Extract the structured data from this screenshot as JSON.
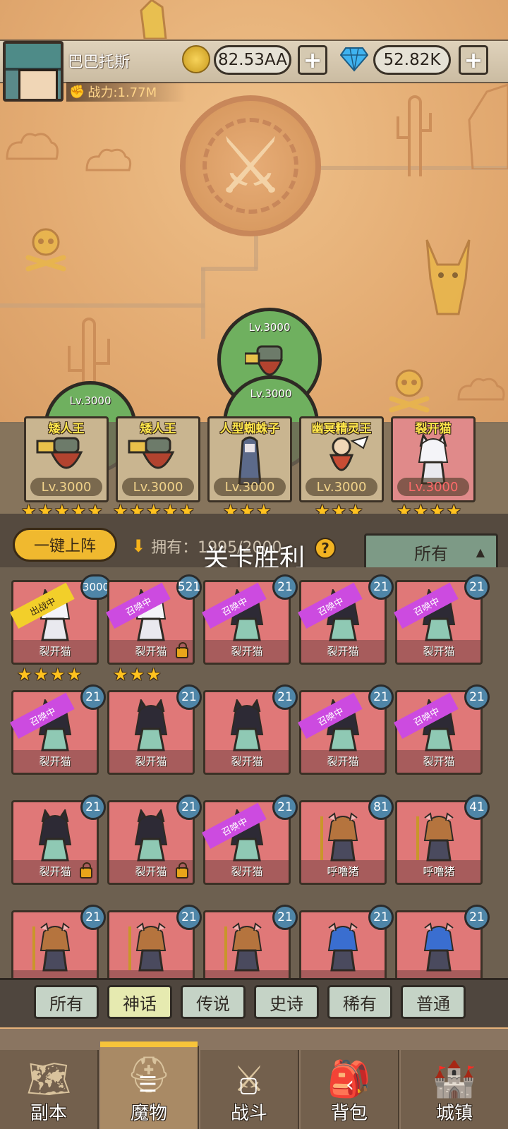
{
  "player": {
    "name": "巴巴托斯",
    "power_label": "战力:1.77M"
  },
  "resources": {
    "gold": "82.53AA",
    "gems": "52.82K",
    "plus": "+"
  },
  "field_units": [
    {
      "level": "Lv.3000"
    },
    {
      "level": "Lv.3000"
    },
    {
      "level": "Lv.3000"
    }
  ],
  "lineup": [
    {
      "name": "矮人王",
      "level": "Lv.3000",
      "stars": 5,
      "rarity": "yellow"
    },
    {
      "name": "矮人王",
      "level": "Lv.3000",
      "stars": 5,
      "rarity": "yellow"
    },
    {
      "name": "人型蜘蛛子",
      "level": "Lv.3000",
      "stars": 3,
      "rarity": "yellow"
    },
    {
      "name": "幽冥精灵王",
      "level": "Lv.3000",
      "stars": 3,
      "rarity": "yellow"
    },
    {
      "name": "裂开猫",
      "level": "Lv.3000",
      "stars": 4,
      "rarity": "pink"
    }
  ],
  "controls": {
    "quick_deploy": "一键上阵",
    "own_label": "拥有：1995/2000",
    "help": "?",
    "filter": "所有",
    "toast": "关卡胜利"
  },
  "monsters": [
    {
      "name": "裂开猫",
      "level": "3000",
      "tag": "出战中",
      "tag_type": "battle",
      "locked": false,
      "stars": 4,
      "kind": "cat-white"
    },
    {
      "name": "裂开猫",
      "level": "521",
      "tag": "召唤中",
      "tag_type": "summon",
      "locked": true,
      "stars": 3,
      "kind": "cat-white"
    },
    {
      "name": "裂开猫",
      "level": "21",
      "tag": "召唤中",
      "tag_type": "summon",
      "locked": false,
      "stars": 0,
      "kind": "cat-black"
    },
    {
      "name": "裂开猫",
      "level": "21",
      "tag": "召唤中",
      "tag_type": "summon",
      "locked": false,
      "stars": 0,
      "kind": "cat-black"
    },
    {
      "name": "裂开猫",
      "level": "21",
      "tag": "召唤中",
      "tag_type": "summon",
      "locked": false,
      "stars": 0,
      "kind": "cat-black"
    },
    {
      "name": "裂开猫",
      "level": "21",
      "tag": "召唤中",
      "tag_type": "summon",
      "locked": false,
      "stars": 0,
      "kind": "cat-black"
    },
    {
      "name": "裂开猫",
      "level": "21",
      "tag": "",
      "tag_type": "",
      "locked": false,
      "stars": 0,
      "kind": "cat-black"
    },
    {
      "name": "裂开猫",
      "level": "21",
      "tag": "",
      "tag_type": "",
      "locked": false,
      "stars": 0,
      "kind": "cat-black"
    },
    {
      "name": "裂开猫",
      "level": "21",
      "tag": "召唤中",
      "tag_type": "summon",
      "locked": false,
      "stars": 0,
      "kind": "cat-black"
    },
    {
      "name": "裂开猫",
      "level": "21",
      "tag": "召唤中",
      "tag_type": "summon",
      "locked": false,
      "stars": 0,
      "kind": "cat-black"
    },
    {
      "name": "裂开猫",
      "level": "21",
      "tag": "",
      "tag_type": "",
      "locked": true,
      "stars": 0,
      "kind": "cat-black"
    },
    {
      "name": "裂开猫",
      "level": "21",
      "tag": "",
      "tag_type": "",
      "locked": true,
      "stars": 0,
      "kind": "cat-black"
    },
    {
      "name": "裂开猫",
      "level": "21",
      "tag": "召唤中",
      "tag_type": "summon",
      "locked": false,
      "stars": 0,
      "kind": "cat-black"
    },
    {
      "name": "呼噜猪",
      "level": "81",
      "tag": "",
      "tag_type": "",
      "locked": false,
      "stars": 0,
      "kind": "pig"
    },
    {
      "name": "呼噜猪",
      "level": "41",
      "tag": "",
      "tag_type": "",
      "locked": false,
      "stars": 0,
      "kind": "pig"
    },
    {
      "name": "",
      "level": "21",
      "tag": "",
      "tag_type": "",
      "locked": false,
      "stars": 0,
      "kind": "pig"
    },
    {
      "name": "",
      "level": "21",
      "tag": "",
      "tag_type": "",
      "locked": false,
      "stars": 0,
      "kind": "pig"
    },
    {
      "name": "",
      "level": "21",
      "tag": "",
      "tag_type": "",
      "locked": false,
      "stars": 0,
      "kind": "pig"
    },
    {
      "name": "",
      "level": "21",
      "tag": "",
      "tag_type": "",
      "locked": false,
      "stars": 0,
      "kind": "pig-blue"
    },
    {
      "name": "",
      "level": "21",
      "tag": "",
      "tag_type": "",
      "locked": false,
      "stars": 0,
      "kind": "pig-blue"
    }
  ],
  "rarity_tabs": [
    {
      "label": "所有",
      "active": false
    },
    {
      "label": "神话",
      "active": true
    },
    {
      "label": "传说",
      "active": false
    },
    {
      "label": "史诗",
      "active": false
    },
    {
      "label": "稀有",
      "active": false
    },
    {
      "label": "普通",
      "active": false
    }
  ],
  "nav": [
    {
      "label": "副本",
      "icon": "map-scroll-icon",
      "active": false
    },
    {
      "label": "魔物",
      "icon": "monster-helmet-icon",
      "active": true
    },
    {
      "label": "战斗",
      "icon": "crossed-swords-icon",
      "active": false
    },
    {
      "label": "背包",
      "icon": "backpack-icon",
      "active": false
    },
    {
      "label": "城镇",
      "icon": "castle-icon",
      "active": false
    }
  ],
  "colors": {
    "gold": "#f7d35a",
    "gem": "#3fb3f0",
    "summon_ribbon": "#cc4be0",
    "battle_ribbon": "#f2cf2a",
    "active_tab": "#f7c43a"
  }
}
